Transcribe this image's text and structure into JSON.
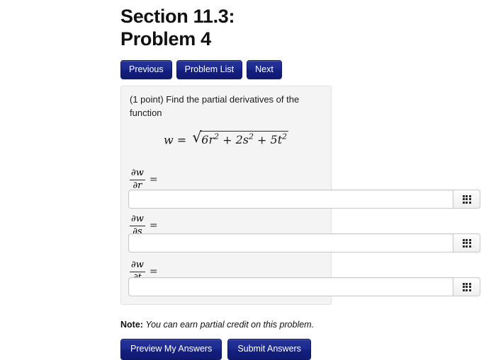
{
  "header": {
    "title": "Section 11.3:\nProblem 4"
  },
  "nav": {
    "previous_label": "Previous",
    "problem_list_label": "Problem List",
    "next_label": "Next"
  },
  "problem": {
    "points_text": "(1 point) Find the partial derivatives of the function",
    "formula": {
      "lhs": "w",
      "equals": "=",
      "radical_glyph": "√",
      "radicand_terms": [
        {
          "coef": "6",
          "var": "r",
          "exp": "2"
        },
        {
          "coef": "2",
          "var": "s",
          "exp": "2"
        },
        {
          "coef": "5",
          "var": "t",
          "exp": "2"
        }
      ],
      "plain_text": "w = √(6r² + 2s² + 5t²)"
    },
    "derivatives": [
      {
        "numerator": "∂w",
        "denominator": "∂r",
        "equals": "=",
        "answer_value": "",
        "answer_placeholder": "",
        "keypad_icon": "grid-3x3-icon"
      },
      {
        "numerator": "∂w",
        "denominator": "∂s",
        "equals": "=",
        "answer_value": "",
        "answer_placeholder": "",
        "keypad_icon": "grid-3x3-icon"
      },
      {
        "numerator": "∂w",
        "denominator": "∂t",
        "equals": "=",
        "answer_value": "",
        "answer_placeholder": "",
        "keypad_icon": "grid-3x3-icon"
      }
    ]
  },
  "note": {
    "label": "Note:",
    "text": "You can earn partial credit on this problem."
  },
  "actions": {
    "preview_label": "Preview My Answers",
    "submit_label": "Submit Answers"
  },
  "colors": {
    "button_blue": "#1d2a8e",
    "button_blue_dark": "#101a72",
    "panel_bg": "#f4f4f4",
    "panel_border": "#e3e3e3",
    "input_border": "#c9c9c9",
    "text": "#111111"
  }
}
